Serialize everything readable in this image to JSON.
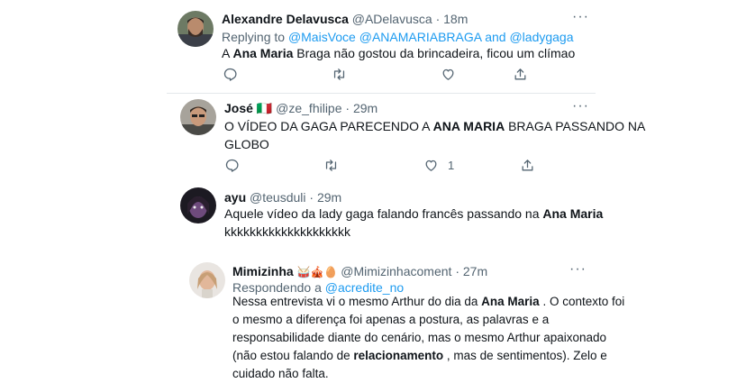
{
  "tweets": [
    {
      "name": "Alexandre Delavusca",
      "handle": "@ADelavusca",
      "time": "18m",
      "replying_prefix": "Replying to",
      "replying_to_1": "@MaisVoce",
      "replying_to_2": "@ANAMARIABRAGA",
      "replying_joiner": "and",
      "replying_to_3": "@ladygaga",
      "text_pre": "A",
      "text_bold": "Ana Maria",
      "text_post": "Braga não gostou da brincadeira, ficou um clímao"
    },
    {
      "name": "José",
      "flag": "🇮🇹",
      "handle": "@ze_fhilipe",
      "time": "29m",
      "text_line1_pre": "O VÍDEO DA GAGA PARECENDO A",
      "text_bold": "ANA MARIA",
      "text_line1_post": "BRAGA PASSANDO NA",
      "text_line2": "GLOBO",
      "like_count": "1"
    },
    {
      "name": "ayu",
      "handle": "@teusduli",
      "time": "29m",
      "text_line1_pre": "Aquele vídeo da lady gaga falando francês passando na",
      "text_bold": "Ana Maria",
      "text_line2": "kkkkkkkkkkkkkkkkkkkk"
    },
    {
      "name": "Mimizinha",
      "emojis": "🥁🎪🥚",
      "handle": "@Mimizinhacoment",
      "time": "27m",
      "replying_prefix": "Respondendo a",
      "replying_to_1": "@acredite_no",
      "line1_pre": "Nessa entrevista vi o mesmo Arthur do dia da",
      "line1_bold": "Ana Maria",
      "line1_post": ". O contexto foi",
      "line2": "o mesmo a diferença foi apenas a postura, as palavras e a",
      "line3": "responsabilidade diante do cenário, mas o mesmo Arthur apaixonado",
      "line4_pre": "(não estou falando de",
      "line4_bold": "relacionamento",
      "line4_post": ", mas de sentimentos). Zelo e",
      "line5": "cuidado não falta."
    }
  ],
  "separator": "·",
  "more_glyph": "···",
  "icons": [
    "reply-icon",
    "retweet-icon",
    "like-icon",
    "share-icon",
    "more-icon"
  ]
}
